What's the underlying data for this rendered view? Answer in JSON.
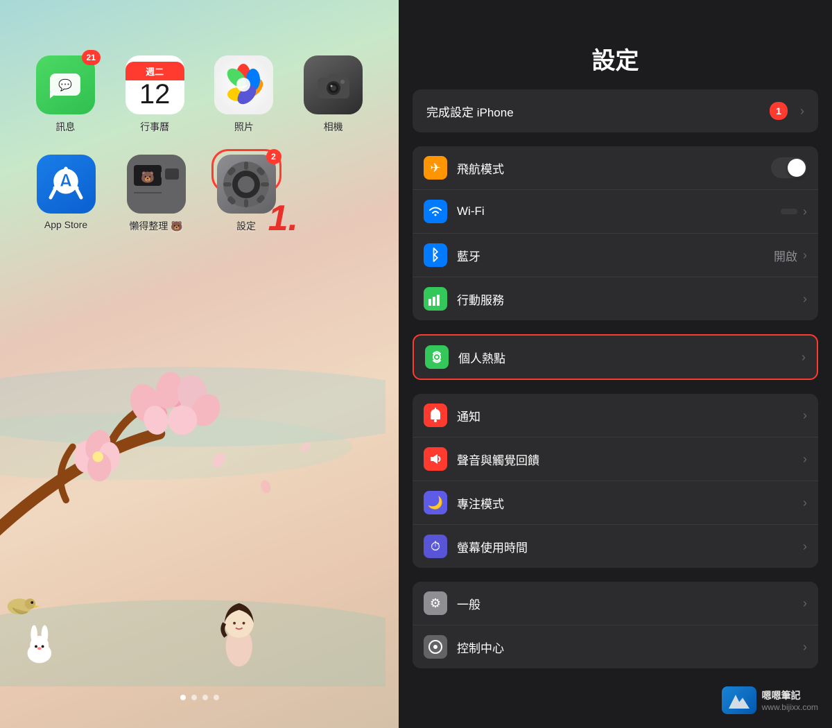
{
  "home": {
    "apps_row1": [
      {
        "id": "messages",
        "label": "訊息",
        "badge": "21",
        "icon_type": "messages"
      },
      {
        "id": "calendar",
        "label": "行事曆",
        "badge": null,
        "icon_type": "calendar",
        "day": "週二",
        "date": "12"
      },
      {
        "id": "photos",
        "label": "照片",
        "badge": null,
        "icon_type": "photos"
      },
      {
        "id": "camera",
        "label": "相機",
        "badge": null,
        "icon_type": "camera"
      }
    ],
    "apps_row2": [
      {
        "id": "appstore",
        "label": "App Store",
        "badge": null,
        "icon_type": "appstore"
      },
      {
        "id": "lazy",
        "label": "懶得整理 🐻",
        "badge": null,
        "icon_type": "lazy"
      },
      {
        "id": "settings",
        "label": "設定",
        "badge": "2",
        "icon_type": "settings",
        "highlighted": true
      }
    ],
    "step_label": "1.",
    "page_dots": [
      true,
      false,
      false,
      false
    ]
  },
  "settings": {
    "title": "設定",
    "setup_row": {
      "label": "完成設定 iPhone",
      "badge": "1"
    },
    "groups": [
      {
        "id": "connectivity",
        "rows": [
          {
            "id": "airplane",
            "icon_class": "icon-orange",
            "icon": "✈",
            "label": "飛航模式",
            "toggle": true,
            "toggle_on": false
          },
          {
            "id": "wifi",
            "icon_class": "icon-blue",
            "icon": "📶",
            "label": "Wi-Fi",
            "value_box": true,
            "value": ""
          },
          {
            "id": "bluetooth",
            "icon_class": "icon-blue2",
            "icon": "🔷",
            "label": "藍牙",
            "value": "開啟"
          },
          {
            "id": "cellular",
            "icon_class": "icon-green",
            "icon": "📡",
            "label": "行動服務",
            "value": ""
          }
        ]
      },
      {
        "id": "hotspot",
        "highlighted": true,
        "rows": [
          {
            "id": "hotspot",
            "icon_class": "icon-green2",
            "icon": "🔗",
            "label": "個人熱點",
            "value": ""
          }
        ]
      },
      {
        "id": "notifications",
        "rows": [
          {
            "id": "notifications",
            "icon_class": "icon-red",
            "icon": "🔔",
            "label": "通知",
            "value": ""
          },
          {
            "id": "sounds",
            "icon_class": "icon-red2",
            "icon": "🔊",
            "label": "聲音與觸覺回饋",
            "value": ""
          },
          {
            "id": "focus",
            "icon_class": "icon-indigo",
            "icon": "🌙",
            "label": "專注模式",
            "value": ""
          },
          {
            "id": "screentime",
            "icon_class": "icon-purple",
            "icon": "⏱",
            "label": "螢幕使用時間",
            "value": ""
          }
        ]
      },
      {
        "id": "general",
        "rows": [
          {
            "id": "general",
            "icon_class": "icon-gray",
            "icon": "⚙",
            "label": "一般",
            "value": ""
          },
          {
            "id": "controlcenter",
            "icon_class": "icon-gray2",
            "icon": "◼",
            "label": "控制中心",
            "value": ""
          }
        ]
      }
    ],
    "watermark": {
      "url": "www.bijixx.com",
      "logo_text": "嗯嗯\n筆記"
    }
  }
}
